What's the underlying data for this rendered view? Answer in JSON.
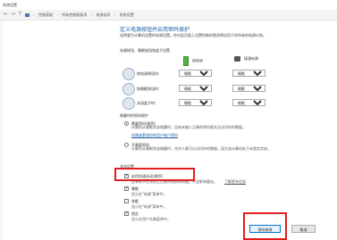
{
  "window": {
    "title": "系统设置"
  },
  "breadcrumb": {
    "items": [
      "控制面板",
      "所有控制面板项",
      "电源选项",
      "系统设置"
    ]
  },
  "page": {
    "heading": "定义电源按钮并启用密码保护",
    "description": "选择要为计算机设置的电源设置。你对此页面上设置所做的更改将应用于你所有的电源计划。",
    "section_buttons": "电源按钮、睡眠按钮和盖子设置"
  },
  "power_columns": {
    "battery": "用电池",
    "plugged": "接通电源"
  },
  "settings_rows": [
    {
      "label": "按电源按钮时:",
      "battery": "睡眠",
      "plugged": "睡眠"
    },
    {
      "label": "按睡眠按钮时:",
      "battery": "睡眠",
      "plugged": "睡眠"
    },
    {
      "label": "关闭盖子时:",
      "battery": "睡眠",
      "plugged": "睡眠"
    }
  ],
  "password": {
    "section_title": "唤醒时的密码保护",
    "option1_title": "需要密码(推荐)",
    "option1_desc": "计算机从睡眠状态唤醒时，没有未输入正确的密码就无法访问你的数据。",
    "option1_link": "创建或更改你的用户帐户密码",
    "option2_title": "不需要密码",
    "option2_desc": "计算机从睡眠状态唤醒时，任何人都可以访问你的数据，因为该计算机处于未锁定状态。"
  },
  "shutdown": {
    "section_title": "关机设置",
    "fast_startup_label": "启用快速启动(推荐)",
    "fast_startup_desc": "这有助于在关机之后更快地启动电脑。不会影响重启。",
    "fast_startup_link": "了解更多信息",
    "sleep_label": "睡眠",
    "sleep_desc": "显示在\"电源\"菜单中。",
    "hibernate_label": "休眠",
    "hibernate_desc": "显示在\"电源\"菜单中。",
    "lock_label": "锁定",
    "lock_desc": "显示在用户头像菜单中。"
  },
  "buttons": {
    "save": "保存修改",
    "cancel": "取消"
  },
  "colors": {
    "highlight": "#e21d1d",
    "link": "#1a5ea8",
    "heading": "#1a5ea8"
  }
}
